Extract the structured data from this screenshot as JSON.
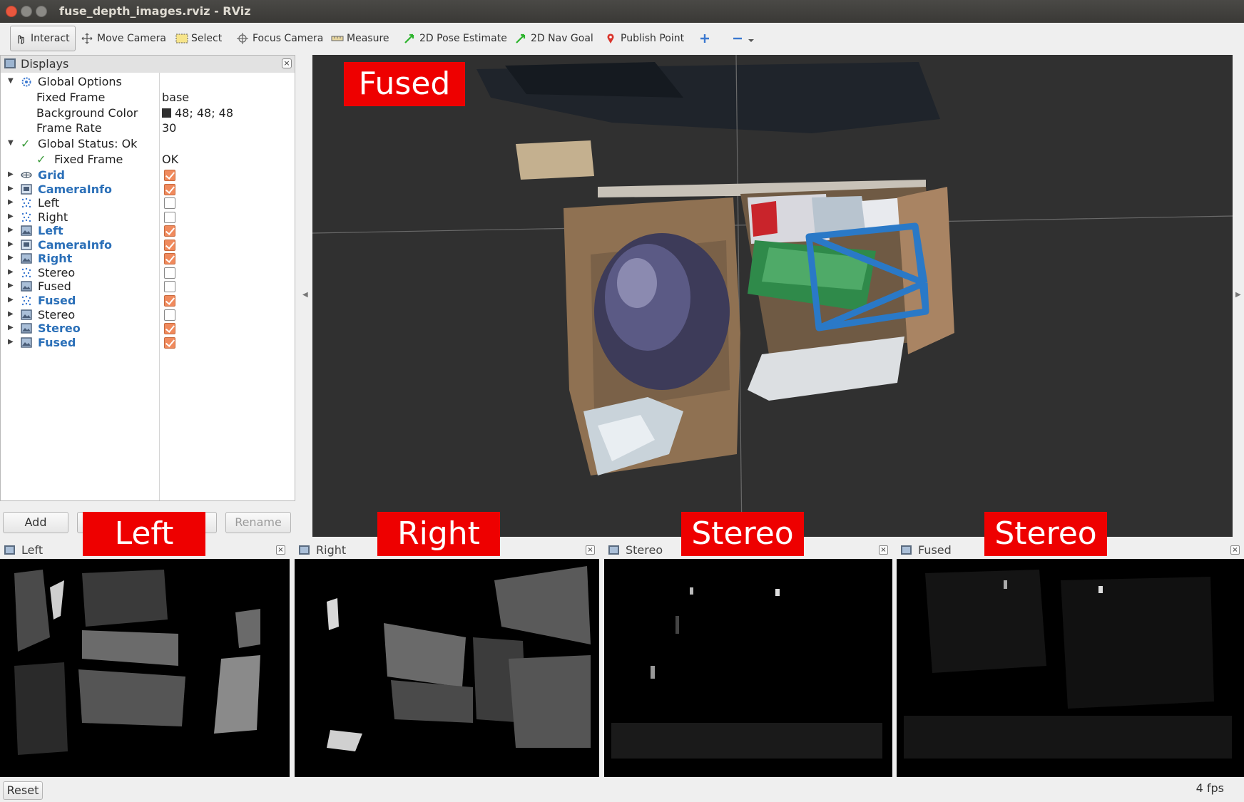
{
  "window": {
    "title": "fuse_depth_images.rviz - RViz"
  },
  "toolbar": {
    "tools": [
      {
        "label": "Interact",
        "icon": "hand-pointer-icon"
      },
      {
        "label": "Move Camera",
        "icon": "move-camera-icon"
      },
      {
        "label": "Select",
        "icon": "select-box-icon"
      },
      {
        "label": "Focus Camera",
        "icon": "crosshair-icon"
      },
      {
        "label": "Measure",
        "icon": "ruler-icon"
      },
      {
        "label": "2D Pose Estimate",
        "icon": "green-arrow-icon"
      },
      {
        "label": "2D Nav Goal",
        "icon": "green-arrow-icon"
      },
      {
        "label": "Publish Point",
        "icon": "map-pin-icon"
      }
    ]
  },
  "displays": {
    "title": "Displays",
    "global_options": {
      "label": "Global Options",
      "fixed_frame": {
        "name": "Fixed Frame",
        "value": "base"
      },
      "background_color": {
        "name": "Background Color",
        "value": "48; 48; 48",
        "color": "#303030"
      },
      "frame_rate": {
        "name": "Frame Rate",
        "value": "30"
      }
    },
    "global_status": {
      "label": "Global Status: Ok",
      "fixed_frame": {
        "name": "Fixed Frame",
        "value": "OK"
      }
    },
    "items": [
      {
        "name": "Grid",
        "bold": true,
        "checked": true,
        "icon": "grid-icon"
      },
      {
        "name": "CameraInfo",
        "bold": true,
        "checked": true,
        "icon": "camera-info-icon"
      },
      {
        "name": "Left",
        "bold": false,
        "checked": false,
        "icon": "pointcloud-icon"
      },
      {
        "name": "Right",
        "bold": false,
        "checked": false,
        "icon": "pointcloud-icon"
      },
      {
        "name": "Left",
        "bold": true,
        "checked": true,
        "icon": "image-icon"
      },
      {
        "name": "CameraInfo",
        "bold": true,
        "checked": true,
        "icon": "camera-info-icon"
      },
      {
        "name": "Right",
        "bold": true,
        "checked": true,
        "icon": "image-icon"
      },
      {
        "name": "Stereo",
        "bold": false,
        "checked": false,
        "icon": "pointcloud-icon"
      },
      {
        "name": "Fused",
        "bold": false,
        "checked": false,
        "icon": "image-icon"
      },
      {
        "name": "Fused",
        "bold": true,
        "checked": true,
        "icon": "pointcloud-icon"
      },
      {
        "name": "Stereo",
        "bold": false,
        "checked": false,
        "icon": "image-icon"
      },
      {
        "name": "Stereo",
        "bold": true,
        "checked": true,
        "icon": "image-icon"
      },
      {
        "name": "Fused",
        "bold": true,
        "checked": true,
        "icon": "image-icon"
      }
    ],
    "buttons": {
      "add": "Add",
      "rename": "Rename"
    }
  },
  "view3d": {
    "overlay_label": "Fused"
  },
  "image_panels": [
    {
      "title": "Left",
      "overlay_label": "Left"
    },
    {
      "title": "Right",
      "overlay_label": "Right"
    },
    {
      "title": "Stereo",
      "overlay_label": "Stereo"
    },
    {
      "title": "Fused",
      "overlay_label": "Stereo"
    }
  ],
  "statusbar": {
    "reset_label": "Reset",
    "fps": "4 fps"
  }
}
